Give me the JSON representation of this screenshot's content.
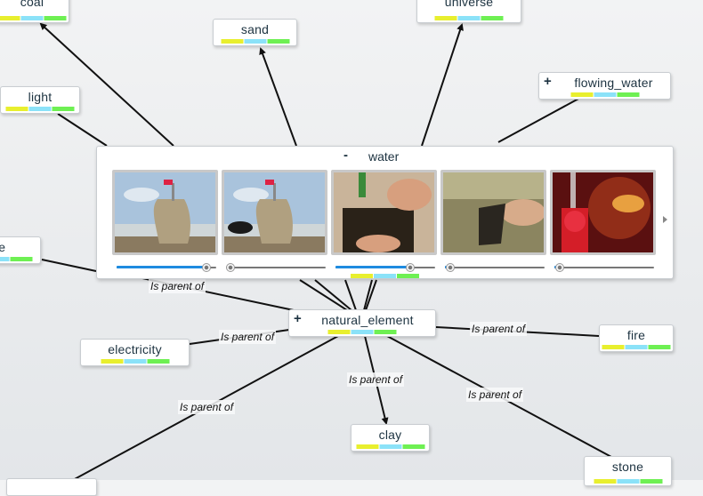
{
  "colors": {
    "bar1": "#e8ef2e",
    "bar2": "#8be2f8",
    "bar3": "#6ef053",
    "edge": "#111111"
  },
  "nodes": [
    {
      "id": "coal",
      "label": "coal",
      "expand": ""
    },
    {
      "id": "sand",
      "label": "sand",
      "expand": ""
    },
    {
      "id": "universe",
      "label": "universe",
      "expand": ""
    },
    {
      "id": "flowing_water",
      "label": "flowing_water",
      "expand": "+"
    },
    {
      "id": "light",
      "label": "light",
      "expand": ""
    },
    {
      "id": "smoke",
      "label": "ke",
      "expand": ""
    },
    {
      "id": "natural_element",
      "label": "natural_element",
      "expand": "+"
    },
    {
      "id": "electricity",
      "label": "electricity",
      "expand": ""
    },
    {
      "id": "fire",
      "label": "fire",
      "expand": ""
    },
    {
      "id": "clay",
      "label": "clay",
      "expand": ""
    },
    {
      "id": "stone",
      "label": "stone",
      "expand": ""
    }
  ],
  "edge_labels": [
    "Is parent of",
    "Is parent of",
    "Is parent of",
    "Is parent of",
    "Is parent of",
    "Is parent of"
  ],
  "panel": {
    "title": "water",
    "collapse": "-",
    "thumbnails": [
      {
        "name": "sand-castle-beach",
        "progress": 0.9
      },
      {
        "name": "sand-castle-dog",
        "progress": 0.0
      },
      {
        "name": "hands-oil-tool",
        "progress": 0.75
      },
      {
        "name": "hands-washing-sink",
        "progress": 0.05
      },
      {
        "name": "fire-hydrant",
        "progress": 0.05
      }
    ]
  }
}
